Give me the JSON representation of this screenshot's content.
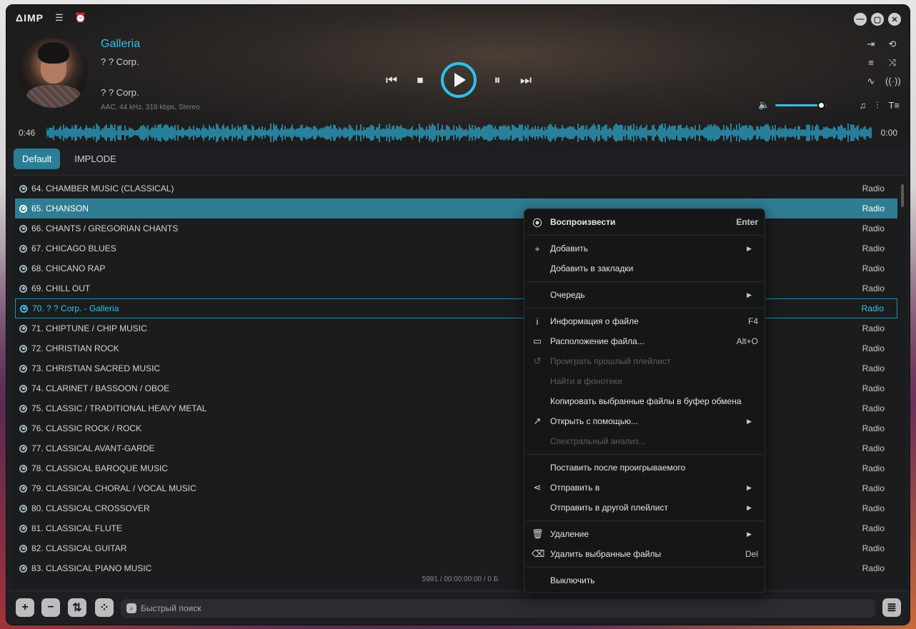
{
  "app": {
    "logo": "ΔIMP",
    "window_buttons": [
      "—",
      "▢",
      "✕"
    ]
  },
  "now_playing": {
    "title": "Galleria",
    "artist": "? ? Corp.",
    "album": "? ? Corp.",
    "format": "AAC, 44 kHz, 319 kbps, Stereo",
    "time_elapsed": "0:46",
    "time_remaining": "0:00",
    "volume": 0.9
  },
  "tabs": [
    {
      "label": "Default",
      "active": true
    },
    {
      "label": "IMPLODE",
      "active": false
    }
  ],
  "playlist": {
    "rows": [
      {
        "title": "64. CHAMBER MUSIC (CLASSICAL)",
        "type": "Radio",
        "state": ""
      },
      {
        "title": "65. CHANSON",
        "type": "Radio",
        "state": "sel"
      },
      {
        "title": "66. CHANTS / GREGORIAN CHANTS",
        "type": "Radio",
        "state": ""
      },
      {
        "title": "67. CHICAGO BLUES",
        "type": "Radio",
        "state": ""
      },
      {
        "title": "68. CHICANO RAP",
        "type": "Radio",
        "state": ""
      },
      {
        "title": "69. CHILL OUT",
        "type": "Radio",
        "state": ""
      },
      {
        "title": "70. ? ? Corp. - Galleria",
        "type": "Radio",
        "state": "playing"
      },
      {
        "title": "71. CHIPTUNE / CHIP MUSIC",
        "type": "Radio",
        "state": ""
      },
      {
        "title": "72. CHRISTIAN ROCK",
        "type": "Radio",
        "state": ""
      },
      {
        "title": "73. CHRISTIAN SACRED MUSIC",
        "type": "Radio",
        "state": ""
      },
      {
        "title": "74. CLARINET / BASSOON / OBOE",
        "type": "Radio",
        "state": ""
      },
      {
        "title": "75. CLASSIC / TRADITIONAL HEAVY METAL",
        "type": "Radio",
        "state": ""
      },
      {
        "title": "76. CLASSIC ROCK / ROCK",
        "type": "Radio",
        "state": ""
      },
      {
        "title": "77. CLASSICAL AVANT-GARDE",
        "type": "Radio",
        "state": ""
      },
      {
        "title": "78. CLASSICAL BAROQUE MUSIC",
        "type": "Radio",
        "state": ""
      },
      {
        "title": "79. CLASSICAL CHORAL / VOCAL MUSIC",
        "type": "Radio",
        "state": ""
      },
      {
        "title": "80. CLASSICAL CROSSOVER",
        "type": "Radio",
        "state": ""
      },
      {
        "title": "81. CLASSICAL FLUTE",
        "type": "Radio",
        "state": ""
      },
      {
        "title": "82. CLASSICAL GUITAR",
        "type": "Radio",
        "state": ""
      },
      {
        "title": "83. CLASSICAL PIANO MUSIC",
        "type": "Radio",
        "state": ""
      }
    ],
    "status": "5991 / 00:00:00:00 / 0 Б"
  },
  "footer": {
    "search_placeholder": "Быстрый поиск"
  },
  "context_menu": {
    "items": [
      {
        "label": "Воспроизвести",
        "shortcut": "Enter",
        "icon": "play-circle-icon",
        "bold": true
      },
      {
        "sep": true
      },
      {
        "label": "Добавить",
        "icon": "plus-icon",
        "submenu": true
      },
      {
        "label": "Добавить в закладки"
      },
      {
        "sep": true
      },
      {
        "label": "Очередь",
        "submenu": true
      },
      {
        "sep": true
      },
      {
        "label": "Информация о файле",
        "shortcut": "F4",
        "icon": "info-icon"
      },
      {
        "label": "Расположение файла...",
        "shortcut": "Alt+O",
        "icon": "folder-icon"
      },
      {
        "label": "Проиграть прошлый плейлист",
        "icon": "history-icon",
        "disabled": true
      },
      {
        "label": "Найти в фонотеке",
        "disabled": true
      },
      {
        "label": "Копировать выбранные файлы в буфер обмена"
      },
      {
        "label": "Открыть с помощью...",
        "icon": "open-external-icon",
        "submenu": true
      },
      {
        "label": "Спектральный анализ...",
        "disabled": true
      },
      {
        "sep": true
      },
      {
        "label": "Поставить после проигрываемого"
      },
      {
        "label": "Отправить в",
        "icon": "share-icon",
        "submenu": true
      },
      {
        "label": "Отправить в другой плейлист",
        "submenu": true
      },
      {
        "sep": true
      },
      {
        "label": "Удаление",
        "icon": "trash-icon",
        "submenu": true
      },
      {
        "label": "Удалить выбранные файлы",
        "shortcut": "Del",
        "icon": "delete-files-icon"
      },
      {
        "sep": true
      },
      {
        "label": "Выключить"
      }
    ]
  },
  "colors": {
    "accent": "#2fc0ec",
    "selected_row": "#2f7d92"
  }
}
